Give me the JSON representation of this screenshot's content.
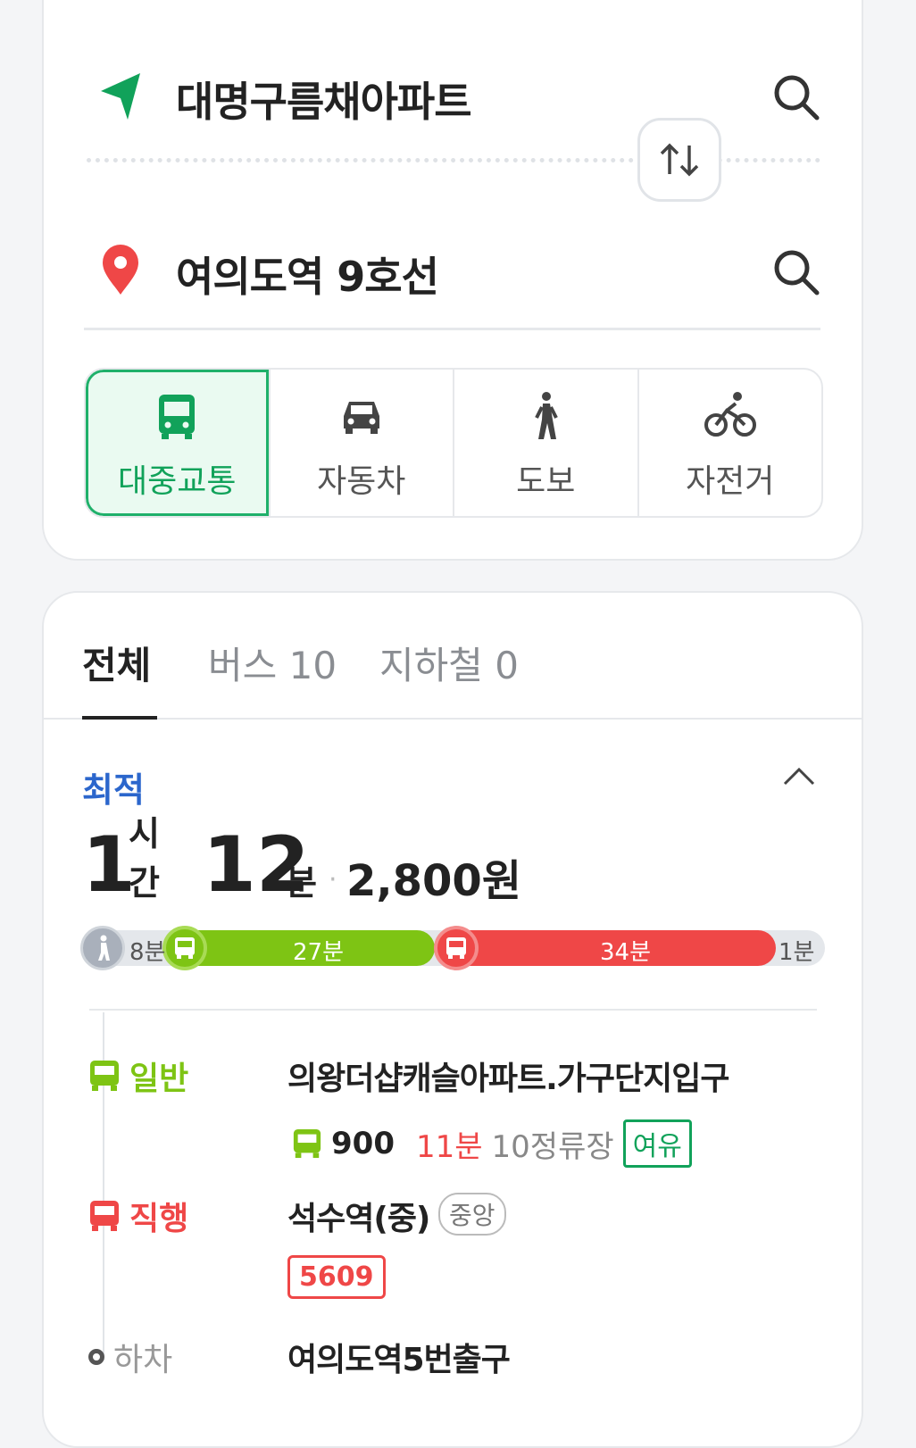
{
  "origin": {
    "name": "대명구름채아파트"
  },
  "destination": {
    "name": "여의도역 9호선"
  },
  "modes": [
    {
      "label": "대중교통",
      "icon": "bus-icon",
      "active": true
    },
    {
      "label": "자동차",
      "icon": "car-icon",
      "active": false
    },
    {
      "label": "도보",
      "icon": "walk-icon",
      "active": false
    },
    {
      "label": "자전거",
      "icon": "bicycle-icon",
      "active": false
    }
  ],
  "tabs": [
    {
      "label": "전체"
    },
    {
      "label": "버스 10"
    },
    {
      "label": "지하철 0"
    }
  ],
  "route": {
    "badge": "최적",
    "hours": "1",
    "hours_unit": "시간",
    "minutes": "12",
    "minutes_unit": "분",
    "separator": "·",
    "fare": "2,800원",
    "bar": {
      "walk1": "8분",
      "bus1": "27분",
      "bus2": "34분",
      "walk2": "1분"
    },
    "steps": [
      {
        "type": "일반",
        "stop": "의왕더샵캐슬아파트.가구단지입구",
        "bus_number": "900",
        "arrival": "11분",
        "stops": "10정류장",
        "crowd": "여유"
      },
      {
        "type": "직행",
        "stop": "석수역(중)",
        "stop_tag": "중앙",
        "bus_number": "5609"
      },
      {
        "type": "하차",
        "stop": "여의도역5번출구"
      }
    ]
  },
  "colors": {
    "accent_green": "#1fb06a",
    "bus_general": "#7ec414",
    "bus_express": "#ef4747",
    "best_blue": "#2b66cc"
  }
}
